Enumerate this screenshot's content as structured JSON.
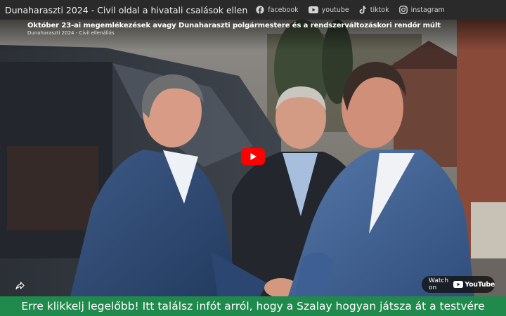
{
  "header": {
    "site_title": "Dunaharaszti 2024 - Civil oldal a hivatali csalások ellen",
    "socials": [
      {
        "label": "facebook",
        "icon": "facebook-icon"
      },
      {
        "label": "youtube",
        "icon": "youtube-icon"
      },
      {
        "label": "tiktok",
        "icon": "tiktok-icon"
      },
      {
        "label": "instagram",
        "icon": "instagram-icon"
      }
    ]
  },
  "video": {
    "title": "Október 23-ai megemlékezések avagy Dunaharaszti polgármestere és a rendszerváltozáskori rendőr múlt",
    "channel": "Dunaharaszti 2024 - Civil ellenállás",
    "watch_on_label": "Watch on",
    "youtube_logo_text": "YouTube",
    "play_button_color": "#ff0000"
  },
  "banner": {
    "text": "Erre klikkelj legelőbb! Itt találsz infót arról, hogy a Szalay hogyan játsza át a testvére",
    "background": "#1f8a4c"
  }
}
